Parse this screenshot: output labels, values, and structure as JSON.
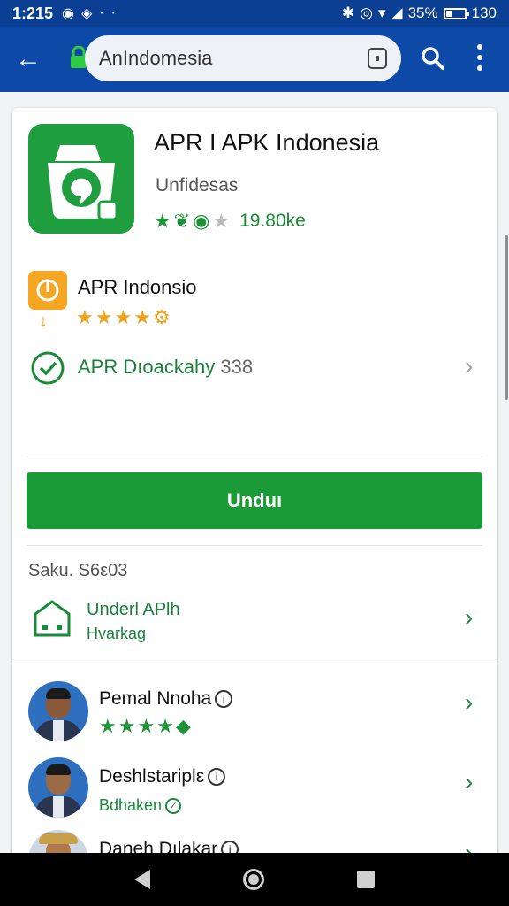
{
  "status_bar": {
    "time": "1:215",
    "battery": "35%",
    "battery_level": 0.35,
    "clock_right": "130"
  },
  "browser": {
    "url": "AnIndomesia"
  },
  "app": {
    "title": "APR I APK Indonesia",
    "subtitle": "Unfidesas",
    "rating_text": "19.80ke",
    "developer_name": "APR Indonsio",
    "verified_label": "APR Dıoackahy",
    "verified_count": "338",
    "download_label": "Unduı",
    "size_text": "Saku. S6ε03",
    "install_title": "Underl APlh",
    "install_subtitle": "Hvarkag"
  },
  "reviews": [
    {
      "name": "Pemal Nnoha",
      "meta": ""
    },
    {
      "name": "Deshlstariplε",
      "meta": "Bdhaken"
    },
    {
      "name": "Daneh Dılakar",
      "meta": ""
    }
  ],
  "colors": {
    "appbar": "#0d4aa8",
    "accent_green": "#1b9a38",
    "star_orange": "#f0a21a"
  }
}
